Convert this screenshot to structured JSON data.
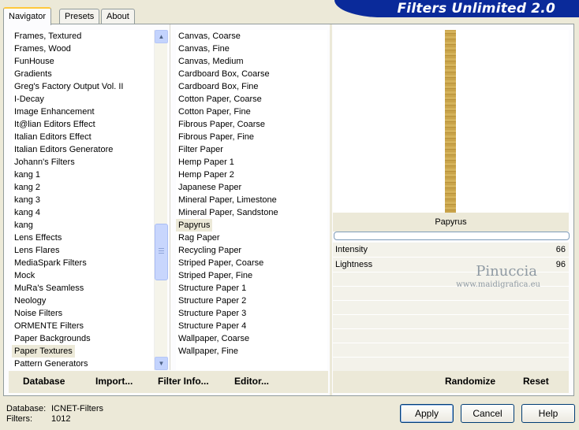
{
  "tabs": [
    "Navigator",
    "Presets",
    "About"
  ],
  "app_title": "Filters Unlimited 2.0",
  "categories": [
    "Frames, Textured",
    "Frames, Wood",
    "FunHouse",
    "Gradients",
    "Greg's Factory Output Vol. II",
    "I-Decay",
    "Image Enhancement",
    "It@lian Editors Effect",
    "Italian Editors Effect",
    "Italian Editors Generatore",
    "Johann's Filters",
    "kang 1",
    "kang 2",
    "kang 3",
    "kang 4",
    "kang",
    "Lens Effects",
    "Lens Flares",
    "MediaSpark Filters",
    "Mock",
    "MuRa's Seamless",
    "Neology",
    "Noise Filters",
    "ORMENTE Filters",
    "Paper Backgrounds",
    "Paper Textures",
    "Pattern Generators"
  ],
  "selected_category": "Paper Textures",
  "filters": [
    "Canvas, Coarse",
    "Canvas, Fine",
    "Canvas, Medium",
    "Cardboard Box, Coarse",
    "Cardboard Box, Fine",
    "Cotton Paper, Coarse",
    "Cotton Paper, Fine",
    "Fibrous Paper, Coarse",
    "Fibrous Paper, Fine",
    "Filter Paper",
    "Hemp Paper 1",
    "Hemp Paper 2",
    "Japanese Paper",
    "Mineral Paper, Limestone",
    "Mineral Paper, Sandstone",
    "Papyrus",
    "Rag Paper",
    "Recycling Paper",
    "Striped Paper, Coarse",
    "Striped Paper, Fine",
    "Structure Paper 1",
    "Structure Paper 2",
    "Structure Paper 3",
    "Structure Paper 4",
    "Wallpaper, Coarse",
    "Wallpaper, Fine"
  ],
  "selected_filter": "Papyrus",
  "preview_name": "Papyrus",
  "params": [
    {
      "label": "Intensity",
      "value": "66"
    },
    {
      "label": "Lightness",
      "value": "96"
    }
  ],
  "watermark": {
    "name": "Pinuccia",
    "url": "www.maidigrafica.eu"
  },
  "left_buttons": {
    "database": "Database",
    "import": "Import...",
    "filter_info": "Filter Info...",
    "editor": "Editor..."
  },
  "right_buttons": {
    "randomize": "Randomize",
    "reset": "Reset"
  },
  "status": {
    "database_label": "Database:",
    "database_value": "ICNET-Filters",
    "filters_label": "Filters:",
    "filters_value": "1012"
  },
  "dialog_buttons": {
    "apply": "Apply",
    "cancel": "Cancel",
    "help": "Help"
  },
  "colors": {
    "banner": "#0a2a9a",
    "face": "#ece9d8"
  }
}
